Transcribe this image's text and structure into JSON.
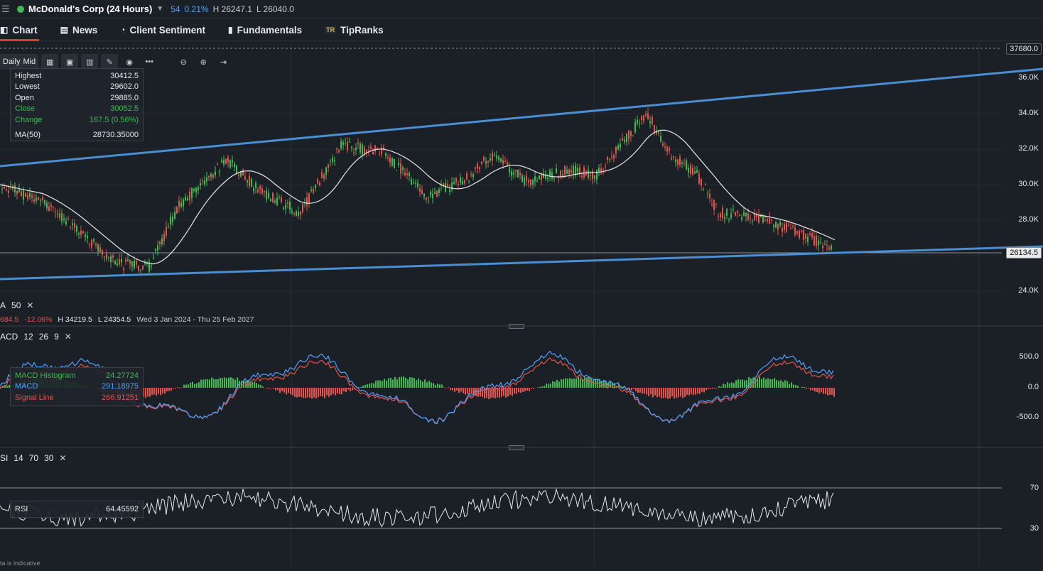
{
  "topbar": {
    "instrument": "McDonald's Corp (24 Hours)",
    "volume": "54",
    "change_pct": "0.21%",
    "high": "H 26247.1",
    "low": "L 26040.0"
  },
  "tabs": [
    {
      "label": "Chart",
      "icon": "chart-icon",
      "active": true
    },
    {
      "label": "News",
      "icon": "news-icon",
      "active": false
    },
    {
      "label": "Client Sentiment",
      "icon": "sentiment-icon",
      "active": false
    },
    {
      "label": "Fundamentals",
      "icon": "bar-chart-icon",
      "active": false
    },
    {
      "label": "TipRanks",
      "icon": "tipranks-logo-icon",
      "active": false
    }
  ],
  "toolbar": {
    "period": "Daily",
    "price_type": "Mid",
    "buttons": [
      "candle-type-icon",
      "indicators-icon",
      "bar-chart-icon",
      "draw-pencil-icon",
      "eye-icon",
      "more-icon",
      "zoom-out-icon",
      "zoom-in-icon",
      "jump-to-end-icon"
    ]
  },
  "ohlc": {
    "highest_label": "Highest",
    "highest": "30412.5",
    "lowest_label": "Lowest",
    "lowest": "29602.0",
    "open_label": "Open",
    "open": "29885.0",
    "close_label": "Close",
    "close": "30052.5",
    "change_label": "Change",
    "change": "167.5 (0.56%)",
    "ma_label": "MA(50)",
    "ma": "28730.35000"
  },
  "price_axis": {
    "top_tag": "37680.0",
    "current_tag": "26134.5",
    "labels": [
      "36.0K",
      "34.0K",
      "32.0K",
      "30.0K",
      "28.0K",
      "24.0K"
    ]
  },
  "ma_indicator": {
    "label": "A",
    "param": "50"
  },
  "stats_line": {
    "change": "684.5",
    "change_pct": "-12.06%",
    "high": "H 34219.5",
    "low": "L 24354.5",
    "range": "Wed 3 Jan 2024 - Thu 25 Feb 2027"
  },
  "macd_indicator": {
    "label": "ACD",
    "p1": "12",
    "p2": "26",
    "p3": "9",
    "histogram_label": "MACD Histogram",
    "histogram": "24.27724",
    "macd_label": "MACD",
    "macd": "291.18975",
    "signal_label": "Signal Line",
    "signal": "266.91251",
    "axis": [
      "500.0",
      "0.0",
      "-500.0"
    ]
  },
  "rsi_indicator": {
    "label": "SI",
    "p1": "14",
    "p2": "70",
    "p3": "30",
    "rsi_label": "RSI",
    "rsi": "64.45592",
    "axis": [
      "70",
      "30"
    ]
  },
  "footer": "ta is indicative",
  "colors": {
    "background": "#1b1f26",
    "up": "#3fb950",
    "down": "#e5534b",
    "trendline": "#4a8fd4",
    "accent": "#e53935",
    "macd": "#4ea1ff",
    "signal": "#e5534b"
  }
}
